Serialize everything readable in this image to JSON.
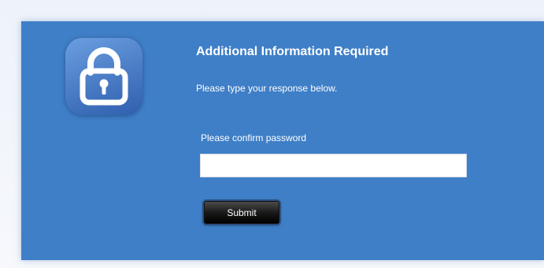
{
  "dialog": {
    "title": "Additional Information Required",
    "instruction": "Please type your response below.",
    "field_label": "Please confirm password",
    "password_value": "",
    "submit_label": "Submit"
  },
  "icons": {
    "badge": "lock-icon"
  },
  "colors": {
    "panel_background": "#3f7fc7",
    "page_background": "#eef3fa",
    "button_background": "#000000",
    "text": "#ffffff"
  }
}
